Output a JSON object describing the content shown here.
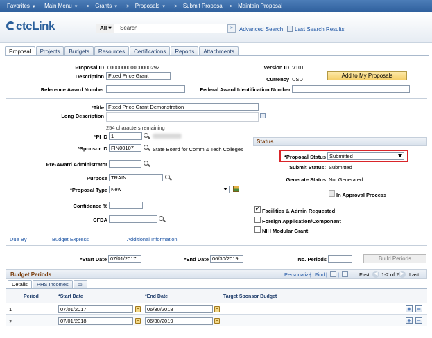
{
  "nav": {
    "favorites": "Favorites",
    "main_menu": "Main Menu",
    "crumbs": [
      "Grants",
      "Proposals",
      "Submit Proposal",
      "Maintain Proposal"
    ]
  },
  "header": {
    "logo": "ctcLink",
    "search_scope": "All",
    "search_placeholder": "Search",
    "advanced_search": "Advanced Search",
    "last_search": "Last Search Results"
  },
  "tabs": [
    "Proposal",
    "Projects",
    "Budgets",
    "Resources",
    "Certifications",
    "Reports",
    "Attachments"
  ],
  "proposal": {
    "proposal_id_label": "Proposal ID",
    "proposal_id": "000000000000000292",
    "description_label": "Description",
    "description": "Fixed Price Grant",
    "reference_award_label": "Reference Award Number",
    "reference_award": "",
    "version_id_label": "Version ID",
    "version_id": "V101",
    "currency_label": "Currency",
    "currency": "USD",
    "add_to_my_proposals": "Add to My Proposals",
    "fed_award_label": "Federal Award Identification Number",
    "fed_award": "",
    "title_label": "*Title",
    "title": "Fixed Price Grant Demonstration",
    "long_desc_label": "Long Description",
    "chars_remaining": "254 characters remaining",
    "pi_id_label": "*PI ID",
    "pi_id": "1",
    "sponsor_id_label": "*Sponsor ID",
    "sponsor_id": "FIN00107",
    "sponsor_name": "State Board for Comm & Tech Colleges",
    "pre_award_label": "Pre-Award Administrator",
    "purpose_label": "Purpose",
    "purpose": "TRAIN",
    "proposal_type_label": "*Proposal Type",
    "proposal_type": "New",
    "confidence_label": "Confidence %",
    "cfda_label": "CFDA"
  },
  "status": {
    "header": "Status",
    "proposal_status_label": "*Proposal Status",
    "proposal_status": "Submitted",
    "submit_status_label": "Submit Status:",
    "submit_status": "Submitted",
    "generate_status_label": "Generate Status",
    "generate_status": "Not Generated",
    "in_approval": "In Approval Process",
    "facilities": "Facilities & Admin Requested",
    "foreign": "Foreign Application/Component",
    "nih": "NIH Modular Grant"
  },
  "links": {
    "due_by": "Due By",
    "budget_express": "Budget Express",
    "additional_info": "Additional Information"
  },
  "dates": {
    "start_label": "*Start Date",
    "start": "07/01/2017",
    "end_label": "*End Date",
    "end": "06/30/2019",
    "no_periods_label": "No. Periods",
    "build_periods": "Build Periods"
  },
  "grid": {
    "title": "Budget Periods",
    "personalize": "Personalize",
    "find": "Find",
    "first": "First",
    "range": "1-2 of 2",
    "last": "Last",
    "subtabs": [
      "Details",
      "PHS Incomes"
    ],
    "columns": [
      "Period",
      "*Start Date",
      "*End Date",
      "Target Sponsor Budget"
    ],
    "rows": [
      {
        "period": "1",
        "start": "07/01/2017",
        "end": "06/30/2018"
      },
      {
        "period": "2",
        "start": "07/01/2018",
        "end": "06/30/2019"
      }
    ]
  }
}
